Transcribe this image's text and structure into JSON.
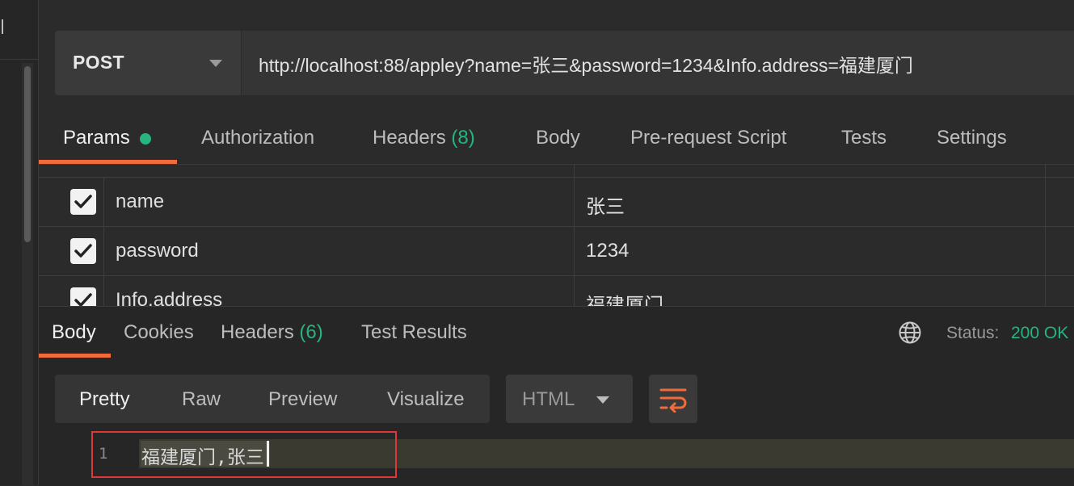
{
  "request": {
    "method": "POST",
    "url": "http://localhost:88/appley?name=张三&password=1234&Info.address=福建厦门"
  },
  "request_tabs": {
    "params": "Params",
    "authorization": "Authorization",
    "headers": "Headers",
    "headers_count": "(8)",
    "body": "Body",
    "pre_request": "Pre-request Script",
    "tests": "Tests",
    "settings": "Settings"
  },
  "params": [
    {
      "key": "name",
      "value": "张三",
      "checked": true
    },
    {
      "key": "password",
      "value": "1234",
      "checked": true
    },
    {
      "key": "Info.address",
      "value": "福建厦门",
      "checked": true
    }
  ],
  "response_tabs": {
    "body": "Body",
    "cookies": "Cookies",
    "headers": "Headers",
    "headers_count": "(6)",
    "test_results": "Test Results"
  },
  "status": {
    "label": "Status:",
    "value": "200 OK"
  },
  "view_modes": {
    "pretty": "Pretty",
    "raw": "Raw",
    "preview": "Preview",
    "visualize": "Visualize"
  },
  "language": "HTML",
  "editor": {
    "line_number": "1",
    "text": "福建厦门,张三"
  },
  "colors": {
    "accent": "#f26b3a",
    "success": "#26b47f",
    "highlight_box": "#e03838"
  },
  "icons": {
    "dropdown": "chevron-down-icon",
    "globe": "globe-icon",
    "wrap": "wrap-lines-icon",
    "check": "check-icon"
  }
}
